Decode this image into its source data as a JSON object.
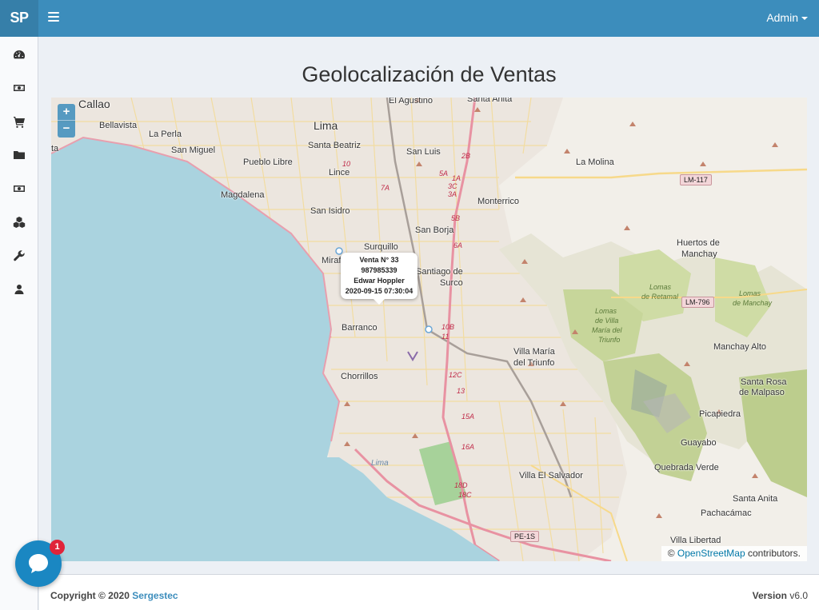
{
  "brand": "SP",
  "user": {
    "name": "Admin"
  },
  "sidebar": {
    "items": [
      {
        "icon": "dashboard-icon"
      },
      {
        "icon": "money-icon"
      },
      {
        "icon": "cart-icon"
      },
      {
        "icon": "folder-icon"
      },
      {
        "icon": "money-icon"
      },
      {
        "icon": "cubes-icon"
      },
      {
        "icon": "wrench-icon"
      },
      {
        "icon": "user-icon"
      }
    ]
  },
  "page": {
    "title": "Geolocalización de Ventas"
  },
  "map": {
    "zoom_in": "+",
    "zoom_out": "−",
    "popup": {
      "line1": "Venta N° 33",
      "line2": "987985339",
      "line3": "Edwar Hoppler",
      "line4": "2020-09-15 07:30:04"
    },
    "attribution": {
      "prefix": "©",
      "link": "OpenStreetMap",
      "suffix": "contributors."
    },
    "labels": {
      "callao": "Callao",
      "bellavista": "Bellavista",
      "laperla": "La Perla",
      "sanmiguel": "San Miguel",
      "pueblolibre": "Pueblo Libre",
      "magdalena": "Magdalena",
      "lima": "Lima",
      "santabeatriz": "Santa Beatriz",
      "lince": "Lince",
      "sanisidro": "San Isidro",
      "elagustino": "El Agustino",
      "santaanita_top": "Santa Anita",
      "sanluis": "San Luis",
      "lamolina": "La Molina",
      "monterrico": "Monterrico",
      "sanborja": "San Borja",
      "surquillo": "Surquillo",
      "miraflores": "Miraflores",
      "santiago1": "Santiago de",
      "santiago2": "Surco",
      "barranco": "Barranco",
      "chorrillos": "Chorrillos",
      "villamaria1": "Villa María",
      "villamaria2": "del Triunfo",
      "huertos1": "Huertos de",
      "huertos2": "Manchay",
      "manchayalto": "Manchay Alto",
      "santarosa1": "Santa Rosa",
      "santarosa2": "de Malpaso",
      "picapiedra": "Picapiedra",
      "guayabo": "Guayabo",
      "quebradaverde": "Quebrada Verde",
      "villaelsalvador": "Villa El Salvador",
      "santaanita": "Santa Anita",
      "pachacamac": "Pachacámac",
      "villalibertad": "Villa Libertad",
      "lomasretamal1": "Lomas",
      "lomasretamal2": "de Retamal",
      "lomasmanchay1": "Lomas",
      "lomasmanchay2": "de Manchay",
      "lomasvilla1": "Lomas",
      "lomasvilla2": "de Villa",
      "lomasvilla3": "María del",
      "lomasvilla4": "Triunfo",
      "lima_coast": "Lima",
      "lm117": "LM-117",
      "lm796": "LM-796",
      "pe1s": "PE-1S",
      "r10b": "10B",
      "r11": "11",
      "r12c": "12C",
      "r13": "13",
      "r15a": "15A",
      "r16a": "16A",
      "r18d": "18D",
      "r18c": "18C",
      "r2b": "2B",
      "r5a": "5A",
      "r1a": "1A",
      "r3c": "3C",
      "r3a": "3A",
      "r5b": "5B",
      "r6a": "6A",
      "r10": "10",
      "r7a": "7A",
      "ta": "ta"
    }
  },
  "footer": {
    "copyright_prefix": "Copyright © 2020",
    "company": "Sergestec",
    "version_label": "Version",
    "version": "v6.0"
  },
  "chat": {
    "badge": "1"
  },
  "colors": {
    "primary": "#3c8dbc",
    "brand_bg": "#367fa9",
    "sea": "#aad3df",
    "land": "#f2efe9",
    "hills": "#cdd9a8",
    "road": "#f7d98a",
    "highway": "#e892a2"
  }
}
